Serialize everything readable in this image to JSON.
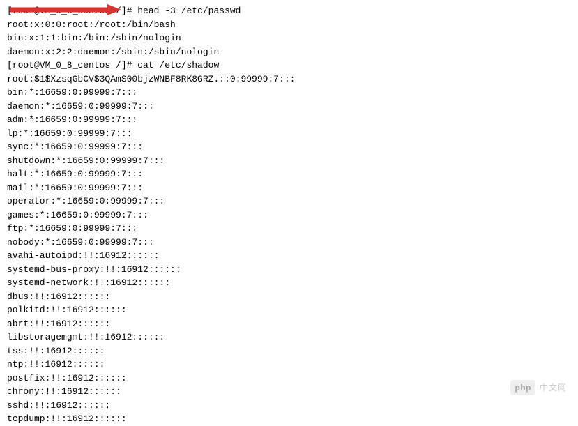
{
  "terminal": {
    "lines": [
      "[root@VM_0_8_centos /]# head -3 /etc/passwd",
      "root:x:0:0:root:/root:/bin/bash",
      "bin:x:1:1:bin:/bin:/sbin/nologin",
      "daemon:x:2:2:daemon:/sbin:/sbin/nologin",
      "[root@VM_0_8_centos /]# cat /etc/shadow",
      "root:$1$XzsqGbCV$3QAmS00bjzWNBF8RK8GRZ.::0:99999:7:::",
      "bin:*:16659:0:99999:7:::",
      "daemon:*:16659:0:99999:7:::",
      "adm:*:16659:0:99999:7:::",
      "lp:*:16659:0:99999:7:::",
      "sync:*:16659:0:99999:7:::",
      "shutdown:*:16659:0:99999:7:::",
      "halt:*:16659:0:99999:7:::",
      "mail:*:16659:0:99999:7:::",
      "operator:*:16659:0:99999:7:::",
      "games:*:16659:0:99999:7:::",
      "ftp:*:16659:0:99999:7:::",
      "nobody:*:16659:0:99999:7:::",
      "avahi-autoipd:!!:16912::::::",
      "systemd-bus-proxy:!!:16912::::::",
      "systemd-network:!!:16912::::::",
      "dbus:!!:16912::::::",
      "polkitd:!!:16912::::::",
      "abrt:!!:16912::::::",
      "libstoragemgmt:!!:16912::::::",
      "tss:!!:16912::::::",
      "ntp:!!:16912::::::",
      "postfix:!!:16912::::::",
      "chrony:!!:16912::::::",
      "sshd:!!:16912::::::",
      "tcpdump:!!:16912::::::"
    ]
  },
  "annotation": {
    "arrow_color": "#d7342f"
  },
  "watermark": {
    "badge": "php",
    "text": "中文网"
  }
}
